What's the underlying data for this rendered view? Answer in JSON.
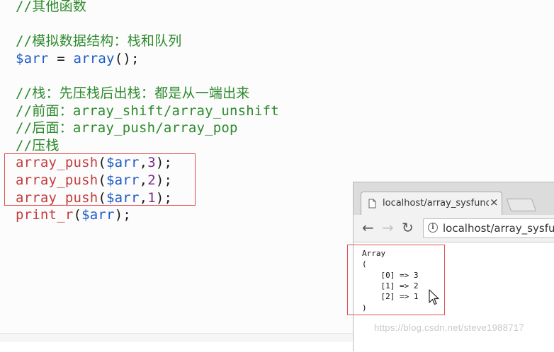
{
  "code": {
    "lines": [
      [
        {
          "t": "//其他函数",
          "c": "c-comment"
        }
      ],
      [],
      [
        {
          "t": "//模拟数据结构：栈和队列",
          "c": "c-comment"
        }
      ],
      [
        {
          "t": "$arr",
          "c": "c-var"
        },
        {
          "t": " = ",
          "c": "c-op"
        },
        {
          "t": "array",
          "c": "c-fn-blue"
        },
        {
          "t": "();",
          "c": "c-punc"
        }
      ],
      [],
      [
        {
          "t": "//栈：先压栈后出栈：都是从一端出来",
          "c": "c-comment"
        }
      ],
      [
        {
          "t": "//前面：array_shift/array_unshift",
          "c": "c-comment"
        }
      ],
      [
        {
          "t": "//后面：array_push/array_pop",
          "c": "c-comment"
        }
      ],
      [
        {
          "t": "//压栈",
          "c": "c-comment"
        }
      ],
      [
        {
          "t": "array_push",
          "c": "c-fn-red"
        },
        {
          "t": "(",
          "c": "c-punc"
        },
        {
          "t": "$arr",
          "c": "c-var"
        },
        {
          "t": ",",
          "c": "c-punc"
        },
        {
          "t": "3",
          "c": "c-num"
        },
        {
          "t": ");",
          "c": "c-punc"
        }
      ],
      [
        {
          "t": "array_push",
          "c": "c-fn-red"
        },
        {
          "t": "(",
          "c": "c-punc"
        },
        {
          "t": "$arr",
          "c": "c-var"
        },
        {
          "t": ",",
          "c": "c-punc"
        },
        {
          "t": "2",
          "c": "c-num"
        },
        {
          "t": ");",
          "c": "c-punc"
        }
      ],
      [
        {
          "t": "array_push",
          "c": "c-fn-red"
        },
        {
          "t": "(",
          "c": "c-punc"
        },
        {
          "t": "$arr",
          "c": "c-var"
        },
        {
          "t": ",",
          "c": "c-punc"
        },
        {
          "t": "1",
          "c": "c-num"
        },
        {
          "t": ");",
          "c": "c-punc"
        }
      ],
      [
        {
          "t": "print_r",
          "c": "c-fn-red"
        },
        {
          "t": "(",
          "c": "c-punc"
        },
        {
          "t": "$arr",
          "c": "c-var"
        },
        {
          "t": ");",
          "c": "c-punc"
        }
      ]
    ]
  },
  "browser": {
    "tab_title": "localhost/array_sysfunc",
    "tab_close": "×",
    "back": "←",
    "forward": "→",
    "reload": "↻",
    "info": "i",
    "url": "localhost/array_sysfunc"
  },
  "output": {
    "lines": [
      "Array",
      "(",
      "    [0] => 3",
      "    [1] => 2",
      "    [2] => 1",
      ")"
    ]
  },
  "watermark": "https://blog.csdn.net/steve1988717",
  "colors": {
    "comment": "#2e8b2e",
    "variable": "#1d5bc7",
    "function": "#c43d3d",
    "number": "#7b2c8a",
    "highlight_box": "#e05050"
  }
}
